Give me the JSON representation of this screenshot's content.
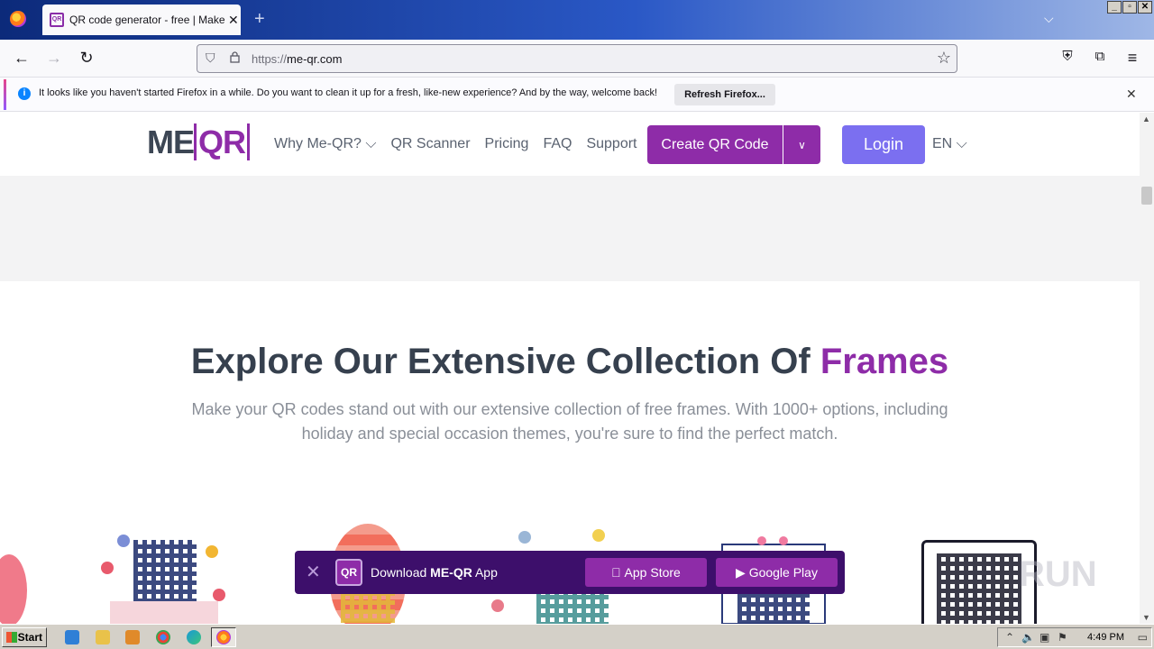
{
  "browser": {
    "tab_title": "QR code generator - free | Make C",
    "tab_favicon_text": "QR",
    "url_protocol": "https://",
    "url_domain": "me-qr.com"
  },
  "notification": {
    "text": "It looks like you haven't started Firefox in a while. Do you want to clean it up for a fresh, like-new experience? And by the way, welcome back!",
    "button": "Refresh Firefox..."
  },
  "site": {
    "logo_left": "ME",
    "logo_right": "QR",
    "nav": [
      "Why Me-QR? ⌵",
      "QR Scanner",
      "Pricing",
      "FAQ",
      "Support"
    ],
    "create_button": "Create QR Code",
    "login_button": "Login",
    "lang": "EN ⌵",
    "headline": "Explore Our Extensive Collection Of ",
    "headline_accent": "Frames",
    "subtext": "Make your QR codes stand out with our extensive collection of free frames. With 1000+ options, including holiday and special occasion themes, you're sure to find the perfect match."
  },
  "app_banner": {
    "logo": "QR",
    "text_prefix": "Download ",
    "text_bold": "ME-QR",
    "text_suffix": " App",
    "app_store": " App Store",
    "google_play": "▶ Google Play"
  },
  "watermark": "RUN",
  "taskbar": {
    "start": "Start",
    "clock": "4:49 PM"
  },
  "colors": {
    "brand_purple": "#8e2ca8",
    "login_purple": "#7b6ff0",
    "banner_bg": "#3d0f6b"
  }
}
